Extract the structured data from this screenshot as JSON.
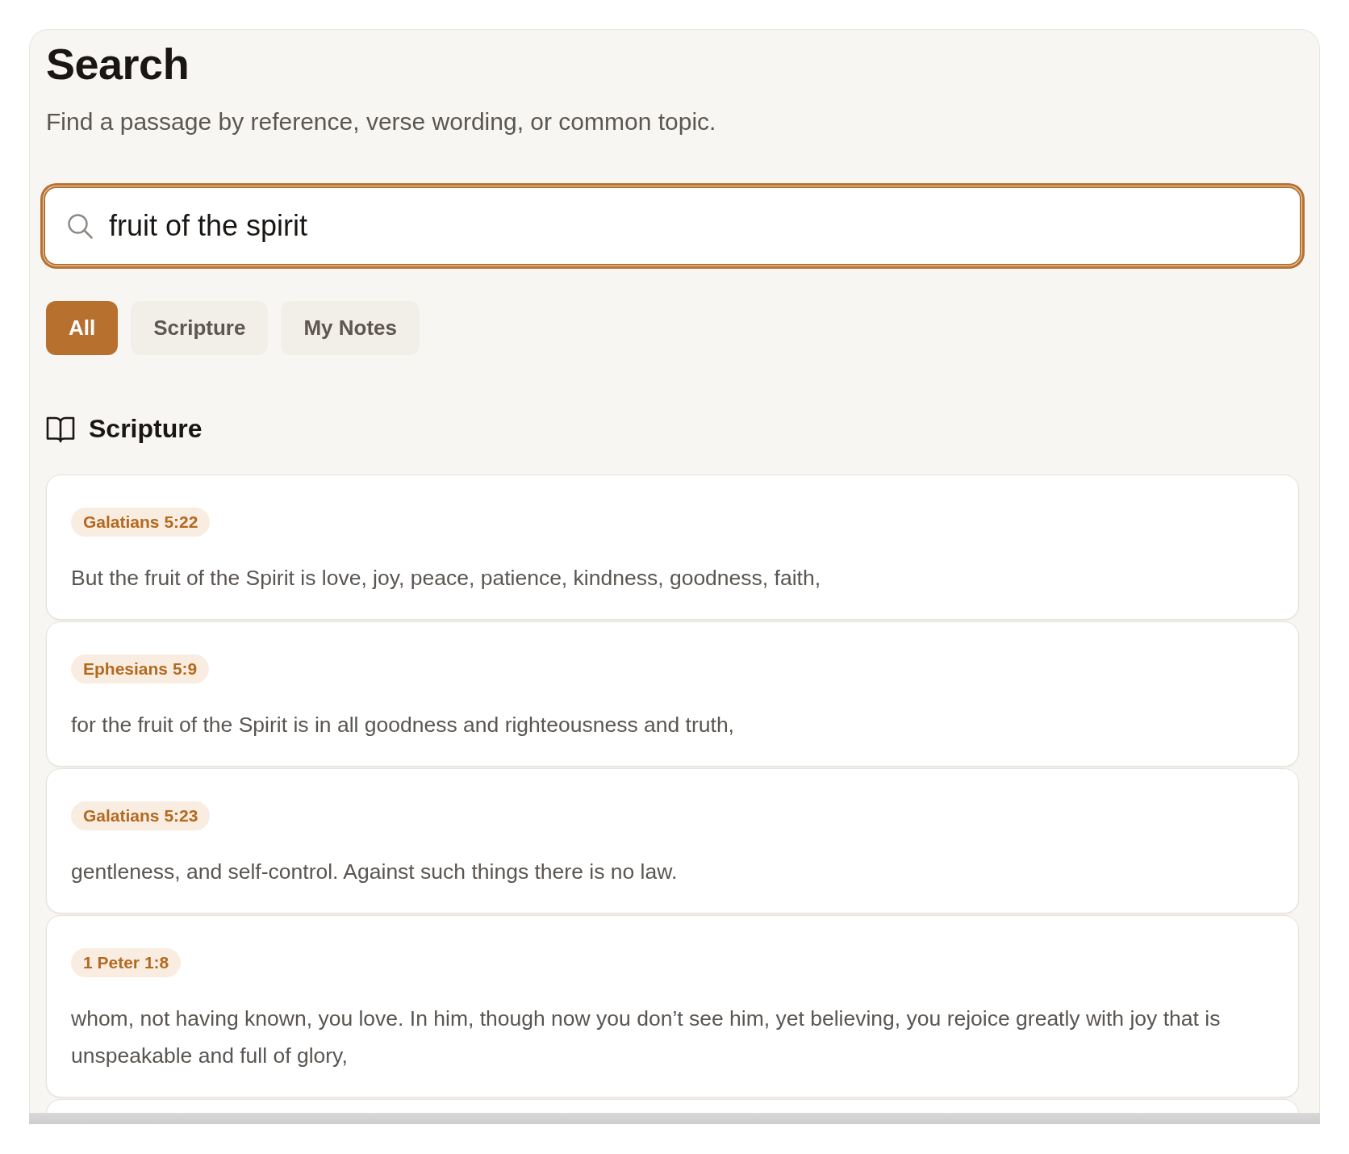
{
  "page": {
    "title": "Search",
    "subtitle": "Find a passage by reference, verse wording, or common topic."
  },
  "search": {
    "value": "fruit of the spirit",
    "focused": true
  },
  "filters": [
    {
      "label": "All",
      "selected": true
    },
    {
      "label": "Scripture",
      "selected": false
    },
    {
      "label": "My Notes",
      "selected": false
    }
  ],
  "section": {
    "title": "Scripture"
  },
  "results": [
    {
      "kind": "verse",
      "reference": "Galatians 5:22",
      "text": "But the fruit of the Spirit is love, joy, peace, patience, kindness, goodness, faith,"
    },
    {
      "kind": "verse",
      "reference": "Ephesians 5:9",
      "text": "for the fruit of the Spirit is in all goodness and righteousness and truth,"
    },
    {
      "kind": "verse",
      "reference": "Galatians 5:23",
      "text": "gentleness, and self-control. Against such things there is no law."
    },
    {
      "kind": "verse",
      "reference": "1 Peter 1:8",
      "text": "whom, not having known, you love. In him, though now you don’t see him, yet believing, you rejoice greatly with joy that is unspeakable and full of glory,"
    },
    {
      "kind": "clipped"
    }
  ]
}
